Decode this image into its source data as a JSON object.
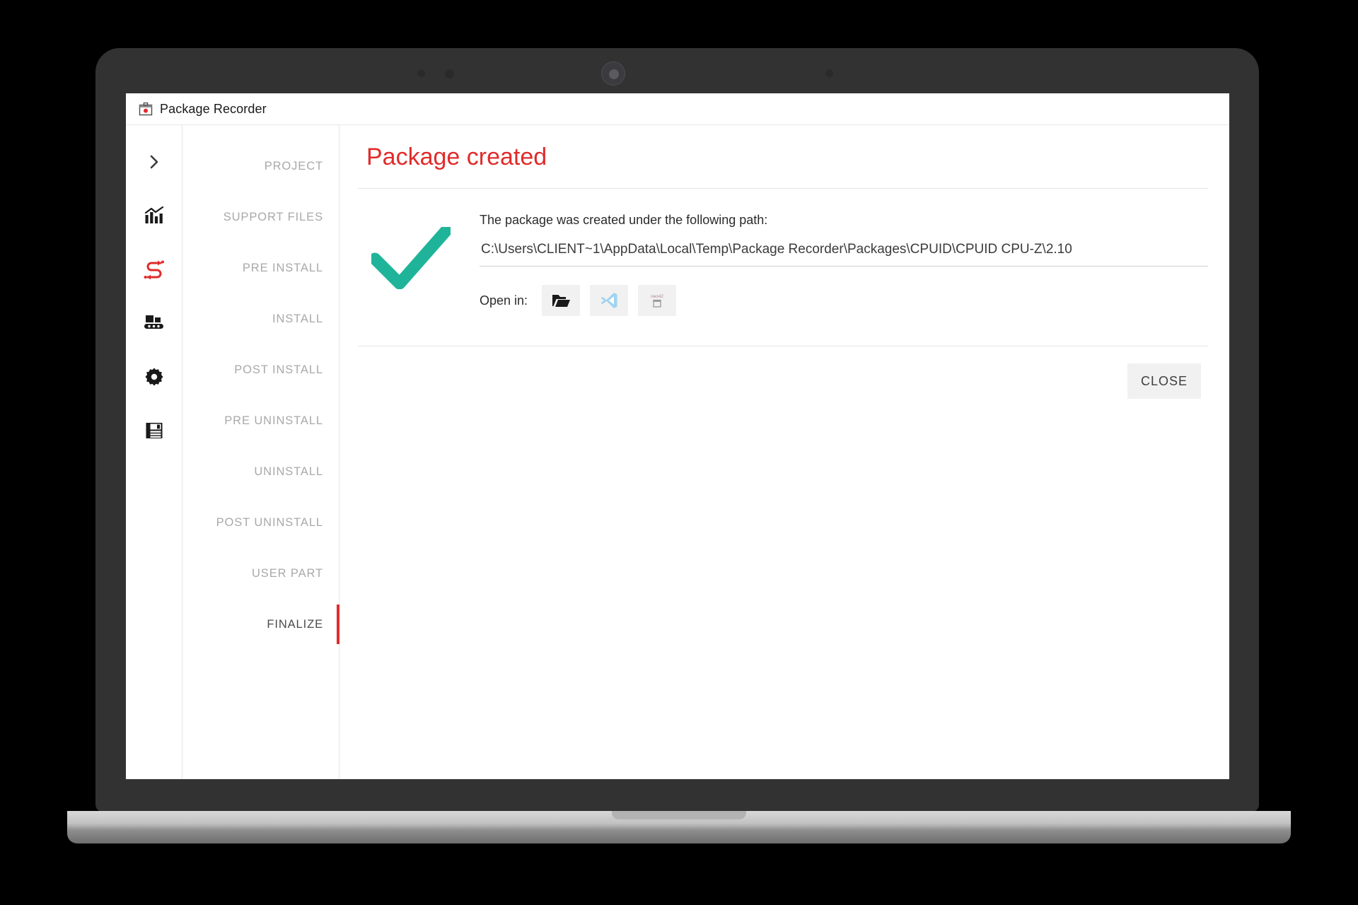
{
  "window": {
    "title": "Package Recorder",
    "icon": "package-recorder-icon"
  },
  "colors": {
    "accent_red": "#e02b2b",
    "check_teal": "#1fb49a",
    "title_red": "#e02b2b",
    "step_inactive": "#a9a9a9",
    "step_active": "#4a4a4a"
  },
  "icon_rail": [
    {
      "name": "expand-chevron-icon",
      "label": "Expand menu"
    },
    {
      "name": "analytics-chart-icon",
      "label": "Analytics"
    },
    {
      "name": "workflow-flow-icon",
      "label": "Workflow"
    },
    {
      "name": "conveyor-packages-icon",
      "label": "Packages"
    },
    {
      "name": "gear-settings-icon",
      "label": "Settings"
    },
    {
      "name": "floppy-save-icon",
      "label": "Save"
    }
  ],
  "steps": [
    {
      "label": "PROJECT",
      "active": false
    },
    {
      "label": "SUPPORT FILES",
      "active": false
    },
    {
      "label": "PRE INSTALL",
      "active": false
    },
    {
      "label": "INSTALL",
      "active": false
    },
    {
      "label": "POST INSTALL",
      "active": false
    },
    {
      "label": "PRE UNINSTALL",
      "active": false
    },
    {
      "label": "UNINSTALL",
      "active": false
    },
    {
      "label": "POST UNINSTALL",
      "active": false
    },
    {
      "label": "USER PART",
      "active": false
    },
    {
      "label": "FINALIZE",
      "active": true
    }
  ],
  "panel": {
    "title": "Package created",
    "status_icon": "success-check-icon",
    "message": "The package was created under the following path:",
    "path": "C:\\Users\\CLIENT~1\\AppData\\Local\\Temp\\Package Recorder\\Packages\\CPUID\\CPUID CPU-Z\\2.10",
    "open_in_label": "Open in:",
    "open_in_buttons": [
      {
        "name": "open-in-explorer-button",
        "icon": "folder-open-icon"
      },
      {
        "name": "open-in-vscode-button",
        "icon": "vscode-icon"
      },
      {
        "name": "open-in-neo42-button",
        "icon": "neo42-icon",
        "glyph": "neo42"
      }
    ],
    "close_label": "CLOSE"
  }
}
